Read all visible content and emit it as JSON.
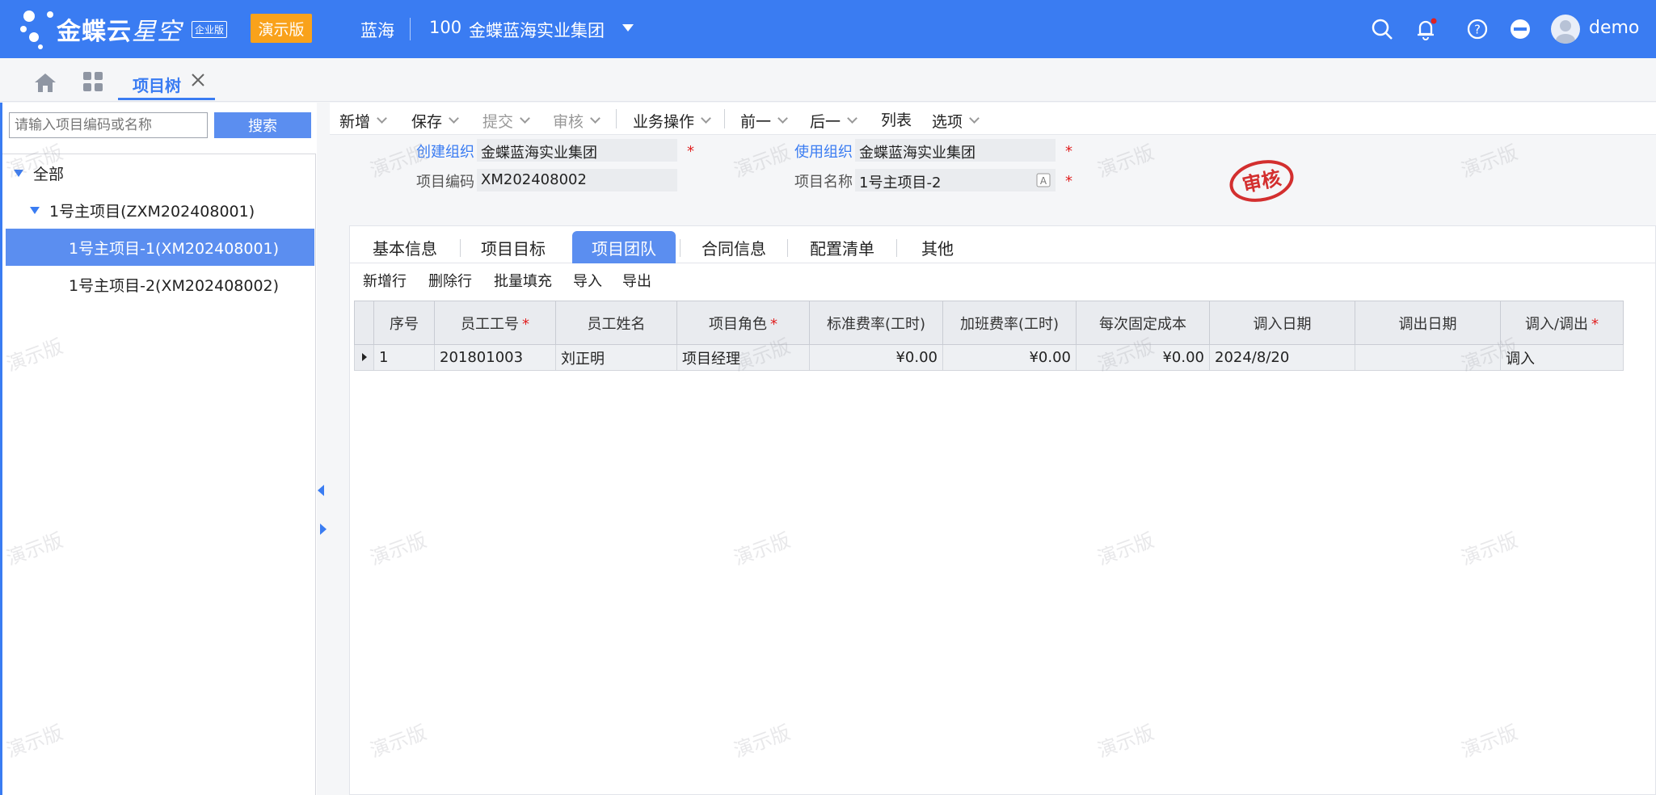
{
  "header": {
    "brand_main": "金蝶云",
    "brand_sub": "星空",
    "edition_badge": "企业版",
    "demo_badge": "演示版",
    "org_short": "蓝海",
    "org_code": "100",
    "org_name": "金蝶蓝海实业集团",
    "user_name": "demo",
    "icons": [
      "search-icon",
      "bell-icon",
      "help-icon",
      "minus-circle-icon"
    ],
    "notification_dot_color": "#e02020"
  },
  "tabs": {
    "active_tab_label": "项目树"
  },
  "left_panel": {
    "search_placeholder": "请输入项目编码或名称",
    "search_button": "搜索",
    "tree": [
      {
        "label": "全部",
        "level": 0,
        "expanded": true
      },
      {
        "label": "1号主项目(ZXM202408001)",
        "level": 1,
        "expanded": true
      },
      {
        "label": "1号主项目-1(XM202408001)",
        "level": 2,
        "selected": true
      },
      {
        "label": "1号主项目-2(XM202408002)",
        "level": 2,
        "selected": false
      }
    ]
  },
  "toolbar": {
    "items": [
      {
        "label": "新增",
        "has_dropdown": true,
        "enabled": true
      },
      {
        "label": "保存",
        "has_dropdown": true,
        "enabled": true
      },
      {
        "label": "提交",
        "has_dropdown": true,
        "enabled": false
      },
      {
        "label": "审核",
        "has_dropdown": true,
        "enabled": false
      },
      {
        "label": "业务操作",
        "has_dropdown": true,
        "enabled": true
      },
      {
        "label": "前一",
        "has_dropdown": true,
        "enabled": true
      },
      {
        "label": "后一",
        "has_dropdown": true,
        "enabled": true
      },
      {
        "label": "列表",
        "has_dropdown": false,
        "enabled": true
      },
      {
        "label": "选项",
        "has_dropdown": true,
        "enabled": true
      }
    ]
  },
  "form": {
    "create_org_label": "创建组织",
    "create_org_value": "金蝶蓝海实业集团",
    "use_org_label": "使用组织",
    "use_org_value": "金蝶蓝海实业集团",
    "project_code_label": "项目编码",
    "project_code_value": "XM202408002",
    "project_name_label": "项目名称",
    "project_name_value": "1号主项目-2",
    "required_mark": "*",
    "status_stamp": "审核"
  },
  "subtabs": {
    "items": [
      "基本信息",
      "项目目标",
      "项目团队",
      "合同信息",
      "配置清单",
      "其他"
    ],
    "active_index": 2
  },
  "grid_toolbar": {
    "items": [
      "新增行",
      "删除行",
      "批量填充",
      "导入",
      "导出"
    ]
  },
  "grid": {
    "columns": [
      {
        "label": "序号",
        "required": false
      },
      {
        "label": "员工工号",
        "required": true
      },
      {
        "label": "员工姓名",
        "required": false
      },
      {
        "label": "项目角色",
        "required": true
      },
      {
        "label": "标准费率(工时)",
        "required": false
      },
      {
        "label": "加班费率(工时)",
        "required": false
      },
      {
        "label": "每次固定成本",
        "required": false
      },
      {
        "label": "调入日期",
        "required": false
      },
      {
        "label": "调出日期",
        "required": false
      },
      {
        "label": "调入/调出",
        "required": true
      }
    ],
    "rows": [
      [
        "1",
        "201801003",
        "刘正明",
        "项目经理",
        "¥0.00",
        "¥0.00",
        "¥0.00",
        "2024/8/20",
        "",
        "调入"
      ]
    ]
  },
  "watermark_text": "演示版",
  "colors": {
    "accent": "#3a7cf2",
    "demo_badge": "#f9a21b",
    "selected_row": "#5b8ef0",
    "required": "#e02020"
  }
}
